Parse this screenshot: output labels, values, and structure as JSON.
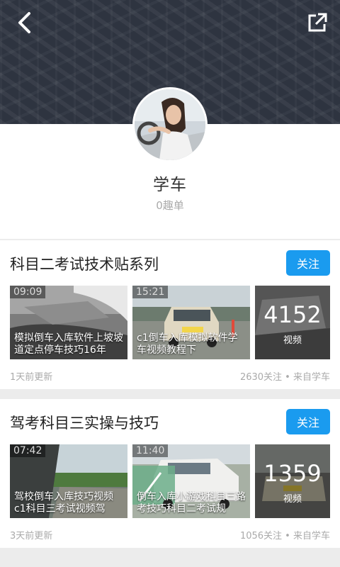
{
  "header": {
    "back_icon": "chevron-left-icon",
    "share_icon": "external-link-icon",
    "background_color": "#2e3440"
  },
  "profile": {
    "name": "学车",
    "subtitle": "0趣单"
  },
  "accent_color": "#1a9bef",
  "cards": [
    {
      "title": "科目二考试技术贴系列",
      "follow_label": "关注",
      "videos": [
        {
          "duration": "09:09",
          "title": "模拟倒车入库软件上坡坡道定点停车技巧16年"
        },
        {
          "duration": "15:21",
          "title": "c1倒车入库模拟软件学车视频教程下"
        }
      ],
      "video_count": "4152",
      "video_count_label": "视频",
      "updated": "1天前更新",
      "meta": "2630关注 • 来自学车"
    },
    {
      "title": "驾考科目三实操与技巧",
      "follow_label": "关注",
      "videos": [
        {
          "duration": "07:42",
          "title": "驾校倒车入库技巧视频c1科目三考试视频驾"
        },
        {
          "duration": "11:40",
          "title": "倒车入库小游戏科目三路考技巧科目二考试规"
        }
      ],
      "video_count": "1359",
      "video_count_label": "视频",
      "updated": "3天前更新",
      "meta": "1056关注 • 来自学车"
    }
  ]
}
